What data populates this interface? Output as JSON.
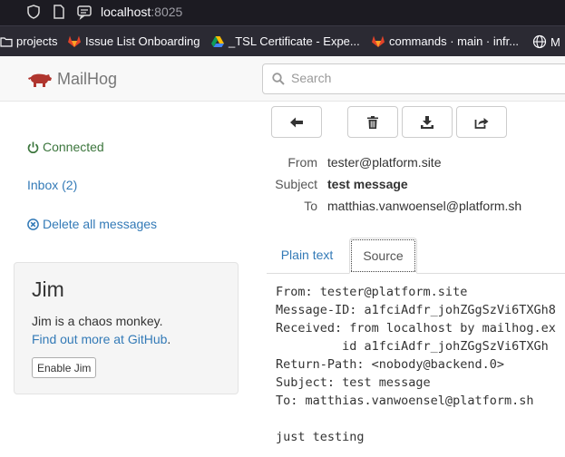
{
  "browser": {
    "url_host": "localhost",
    "url_port": ":8025",
    "bookmarks": [
      {
        "label": "projects"
      },
      {
        "label": "Issue List Onboarding"
      },
      {
        "label": "_TSL Certificate - Expe..."
      },
      {
        "label": "commands · main · infr..."
      },
      {
        "label": "M"
      }
    ]
  },
  "app": {
    "brand": "MailHog",
    "search_placeholder": "Search"
  },
  "sidebar": {
    "connected": "Connected",
    "inbox": "Inbox (2)",
    "delete_all": "Delete all messages"
  },
  "jim": {
    "title": "Jim",
    "description": "Jim is a chaos monkey.",
    "link": "Find out more at GitHub",
    "link_suffix": ".",
    "button": "Enable Jim"
  },
  "message": {
    "from_label": "From",
    "from": "tester@platform.site",
    "subject_label": "Subject",
    "subject": "test message",
    "to_label": "To",
    "to": "matthias.vanwoensel@platform.sh"
  },
  "tabs": {
    "plain": "Plain text",
    "source": "Source"
  },
  "source": {
    "lines": [
      "From: tester@platform.site",
      "Message-ID: a1fciAdfr_johZGgSzVi6TXGh8",
      "Received: from localhost by mailhog.ex",
      "         id a1fciAdfr_johZGgSzVi6TXGh",
      "Return-Path: <nobody@backend.0>",
      "Subject: test message",
      "To: matthias.vanwoensel@platform.sh",
      "",
      "just testing"
    ]
  }
}
